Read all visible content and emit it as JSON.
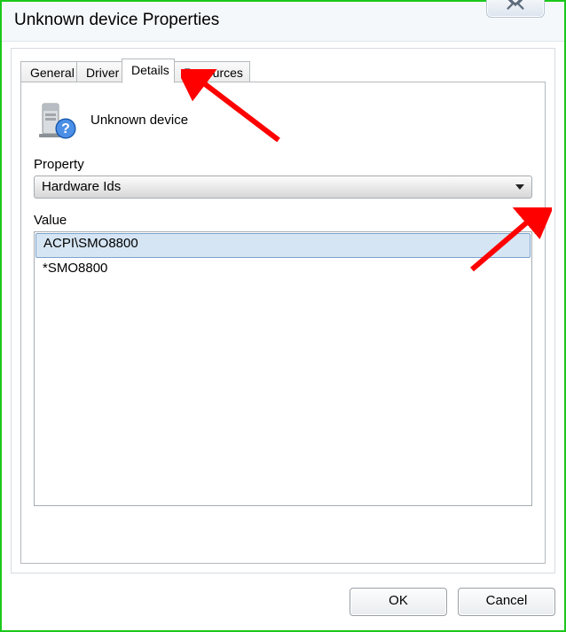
{
  "window": {
    "title": "Unknown device Properties"
  },
  "tabs": [
    {
      "label": "General"
    },
    {
      "label": "Driver"
    },
    {
      "label": "Details"
    },
    {
      "label": "Resources"
    }
  ],
  "details": {
    "device_name": "Unknown device",
    "property_label": "Property",
    "property_selected": "Hardware Ids",
    "value_label": "Value",
    "values": [
      "ACPI\\SMO8800",
      "*SMO8800"
    ]
  },
  "buttons": {
    "ok": "OK",
    "cancel": "Cancel"
  }
}
